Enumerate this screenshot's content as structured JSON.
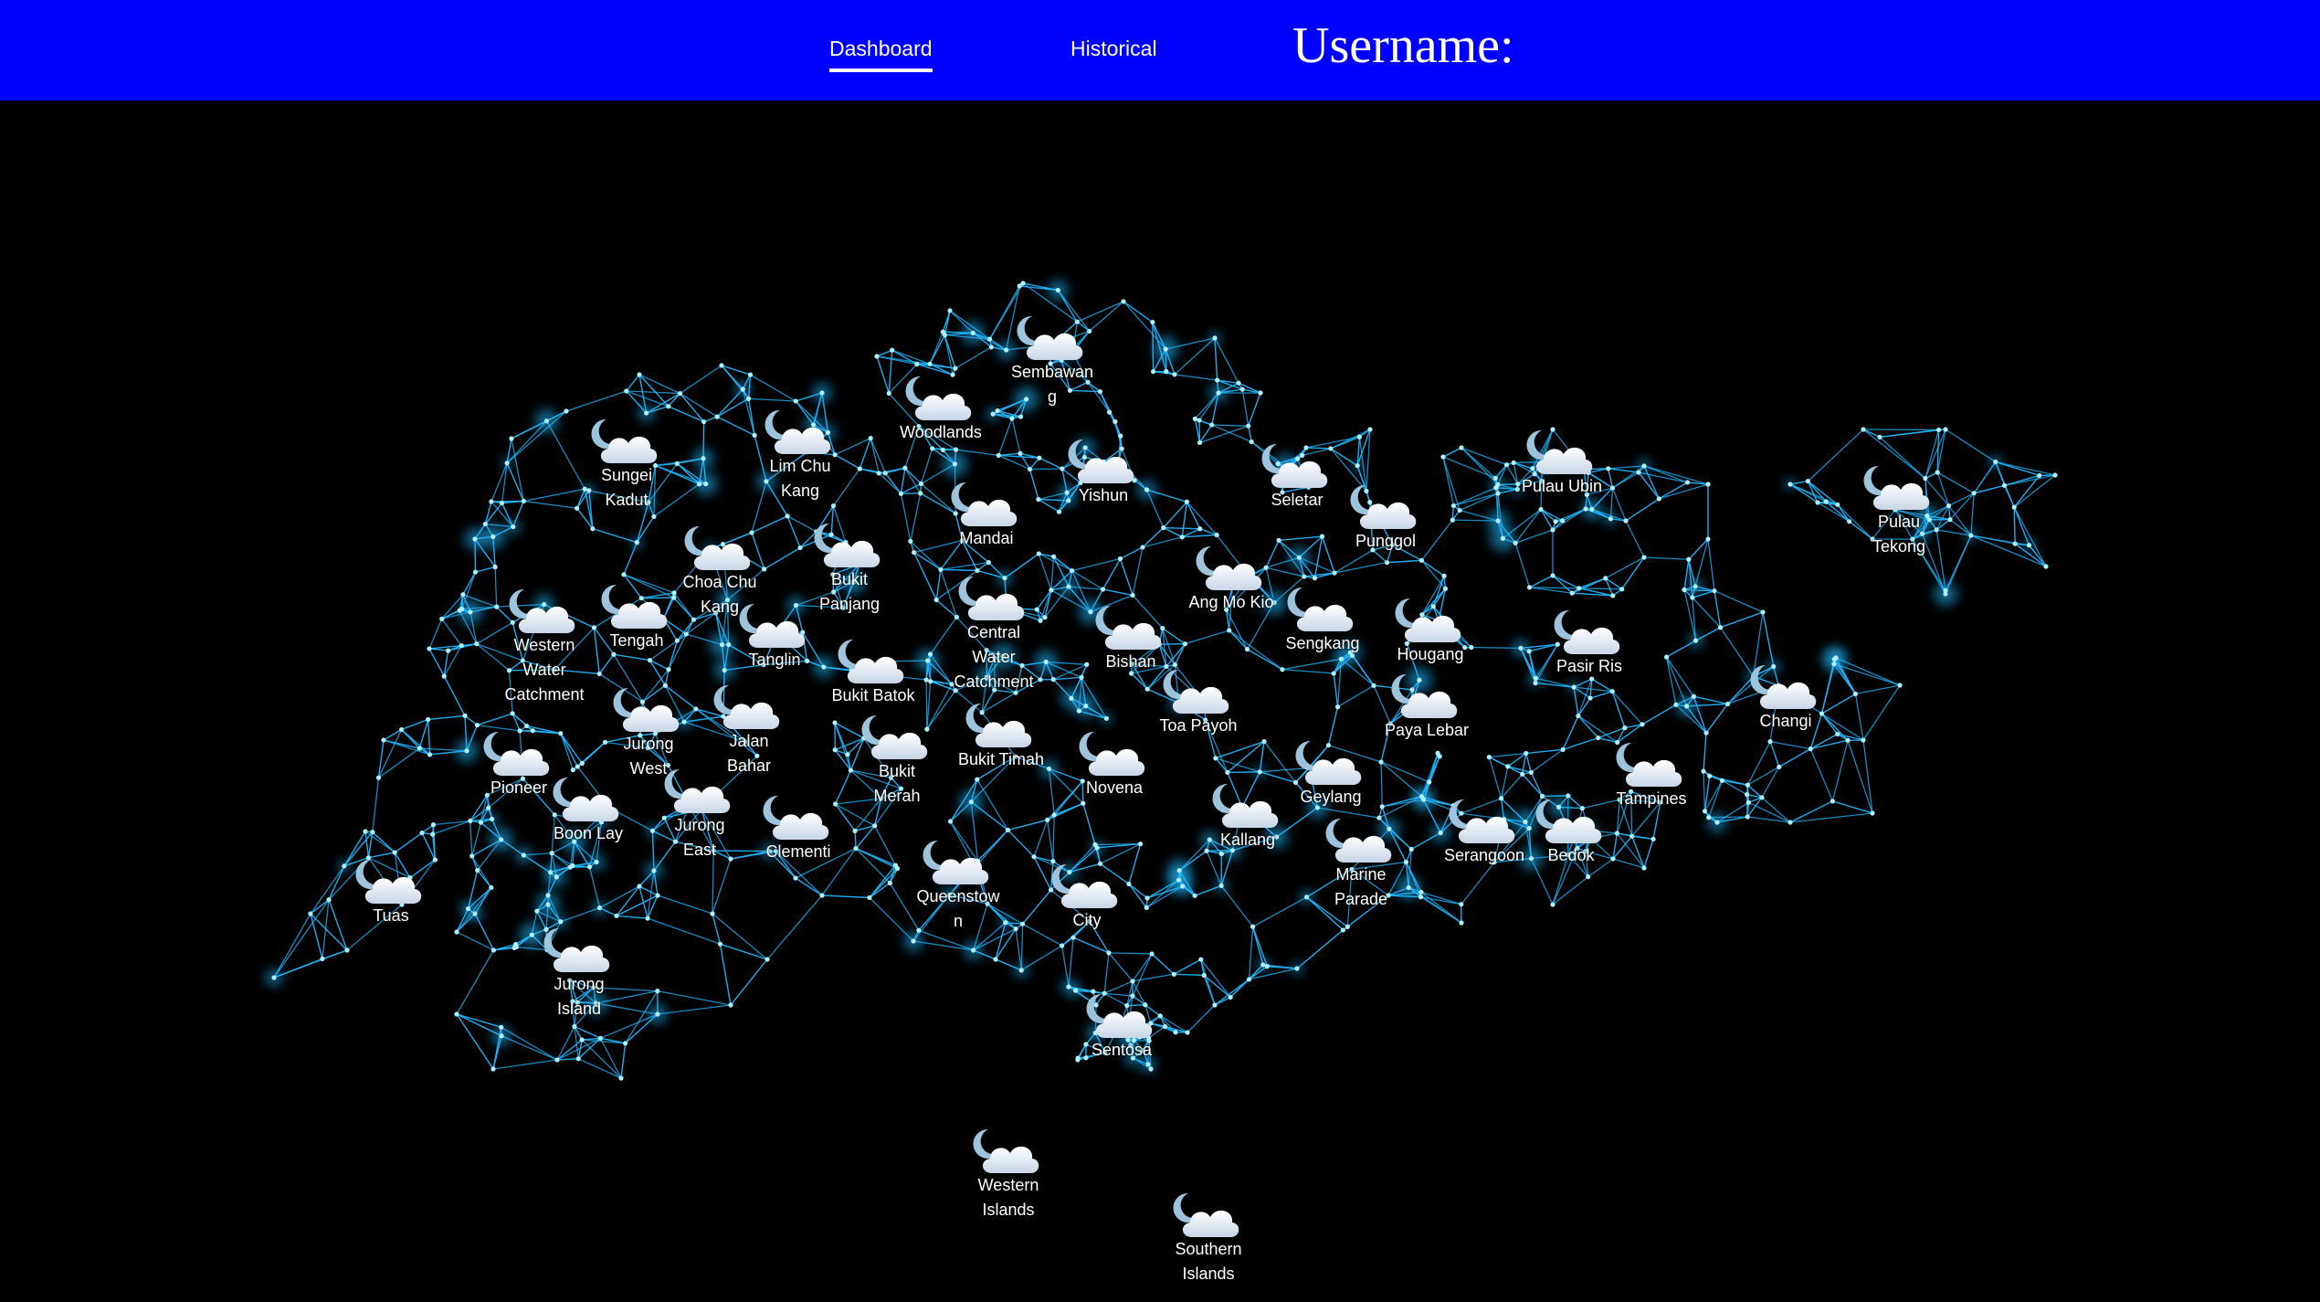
{
  "navbar": {
    "background": "#0000ff",
    "dashboard_label": "Dashboard",
    "historical_label": "Historical",
    "username_label": "Username:"
  },
  "map": {
    "background": "#000000",
    "network_color": "#1fb8ff",
    "weather_icon": "night-cloudy-icon",
    "regions": [
      {
        "name": "Sembawang"
      },
      {
        "name": "Woodlands"
      },
      {
        "name": "Sungei Kadut"
      },
      {
        "name": "Lim Chu Kang"
      },
      {
        "name": "Yishun"
      },
      {
        "name": "Seletar"
      },
      {
        "name": "Pulau Ubin"
      },
      {
        "name": "Pulau Tekong"
      },
      {
        "name": "Mandai"
      },
      {
        "name": "Punggol"
      },
      {
        "name": "Choa Chu Kang"
      },
      {
        "name": "Bukit Panjang"
      },
      {
        "name": "Ang Mo Kio"
      },
      {
        "name": "Western Water Catchment"
      },
      {
        "name": "Tengah"
      },
      {
        "name": "Tanglin"
      },
      {
        "name": "Central Water Catchment"
      },
      {
        "name": "Bishan"
      },
      {
        "name": "Sengkang"
      },
      {
        "name": "Hougang"
      },
      {
        "name": "Pasir Ris"
      },
      {
        "name": "Bukit Batok"
      },
      {
        "name": "Changi"
      },
      {
        "name": "Jurong West"
      },
      {
        "name": "Jalan Bahar"
      },
      {
        "name": "Toa Payoh"
      },
      {
        "name": "Paya Lebar"
      },
      {
        "name": "Bukit Merah"
      },
      {
        "name": "Bukit Timah"
      },
      {
        "name": "Pioneer"
      },
      {
        "name": "Novena"
      },
      {
        "name": "Geylang"
      },
      {
        "name": "Tampines"
      },
      {
        "name": "Jurong East"
      },
      {
        "name": "Boon Lay"
      },
      {
        "name": "Clementi"
      },
      {
        "name": "Kallang"
      },
      {
        "name": "Serangoon"
      },
      {
        "name": "Bedok"
      },
      {
        "name": "Marine Parade"
      },
      {
        "name": "Queenstown"
      },
      {
        "name": "City"
      },
      {
        "name": "Tuas"
      },
      {
        "name": "Jurong Island"
      },
      {
        "name": "Sentosa"
      },
      {
        "name": "Western Islands"
      },
      {
        "name": "Southern Islands"
      }
    ]
  }
}
